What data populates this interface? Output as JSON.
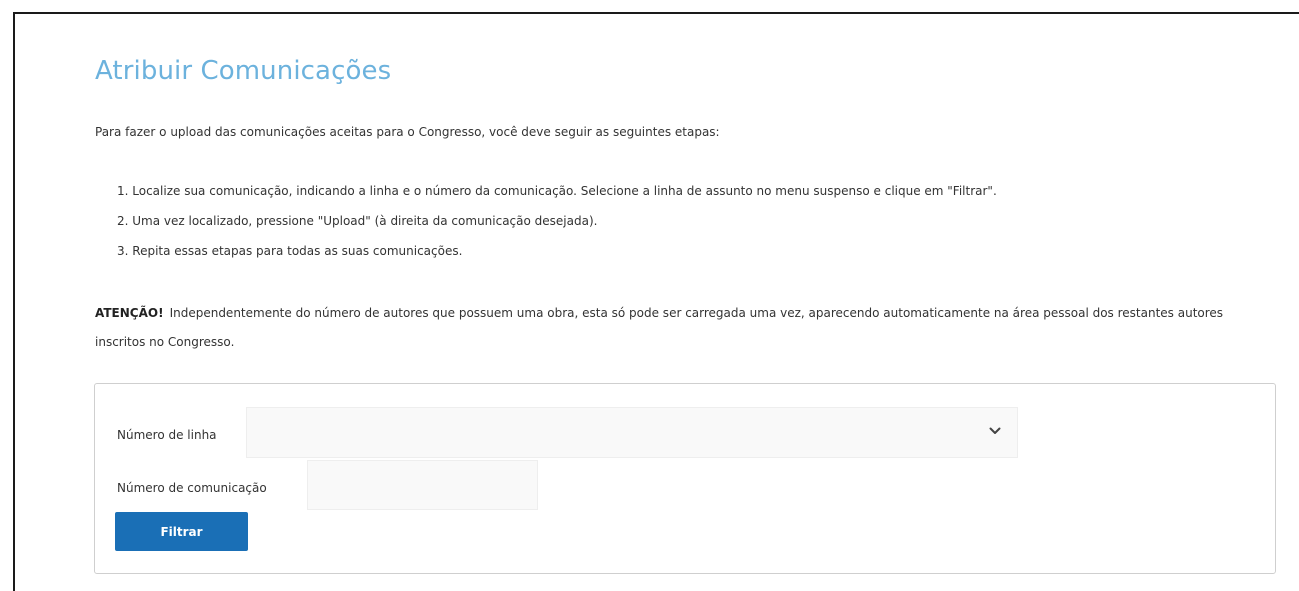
{
  "page": {
    "title": "Atribuir Comunicações",
    "intro": "Para fazer o upload das comunicações aceitas para o Congresso, você deve seguir as seguintes etapas:",
    "steps": [
      "1. Localize sua comunicação, indicando a linha e o número da comunicação. Selecione a linha de assunto no menu suspenso e clique em \"Filtrar\".",
      "2. Uma vez localizado, pressione \"Upload\" (à direita da comunicação desejada).",
      "3. Repita essas etapas para todas as suas comunicações."
    ],
    "attention_label": "ATENÇÃO!",
    "attention_text": "Independentemente do número de autores que possuem uma obra, esta só pode ser carregada uma vez, aparecendo automaticamente na área pessoal dos restantes autores inscritos no Congresso."
  },
  "filter_form": {
    "line_label": "Número de linha",
    "line_value": "",
    "line_icon": "chevron-down-icon",
    "communication_label": "Número de comunicação",
    "communication_value": "",
    "filter_button_label": "Filtrar"
  },
  "colors": {
    "title": "#6cb2dd",
    "button": "#1a6fb6",
    "text": "#333333"
  }
}
